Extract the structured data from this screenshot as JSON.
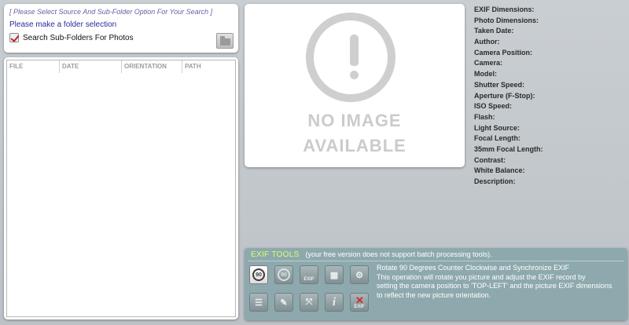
{
  "source": {
    "hint": "[ Please Select Source And Sub-Folder Option For Your Search ]",
    "warning": "Please make a folder selection",
    "checkbox_label": "Search Sub-Folders For Photos"
  },
  "file_list": {
    "columns": [
      "FILE",
      "DATE",
      "ORIENTATION",
      "PATH"
    ]
  },
  "image": {
    "line1": "NO IMAGE",
    "line2": "AVAILABLE"
  },
  "exif_fields": [
    "EXIF Dimensions:",
    "Photo Dimensions:",
    "Taken Date:",
    "Author:",
    "Camera Position:",
    "Camera:",
    "Model:",
    "Shutter Speed:",
    "Aperture (F-Stop):",
    "ISO Speed:",
    "Flash:",
    "Light Source:",
    "Focal Length:",
    "35mm Focal Length:",
    "Contrast:",
    "White Balance:",
    "Description:"
  ],
  "tools": {
    "title": "EXIF TOOLS",
    "note": "(your free version does not support batch processing tools).",
    "rotate_ccw_label": "90",
    "rotate_cw_label": "90",
    "exif_label": "EXIF",
    "delete_exif_label": "EXIF",
    "info_label": "i",
    "description": [
      "Rotate 90 Degrees Counter Clockwise and Synchronize EXIF",
      "This operation will rotate you picture and adjust the EXIF record by",
      "setting the camera position to 'TOP-LEFT' and the picture EXIF dimensions",
      "to reflect the new picture orientation."
    ]
  },
  "colors": {
    "tools_bg": "#8ea9ad",
    "tools_title": "#d7ff6b",
    "hint": "#6b5ea6",
    "warning": "#2d2a9a",
    "check": "#c0242a"
  }
}
